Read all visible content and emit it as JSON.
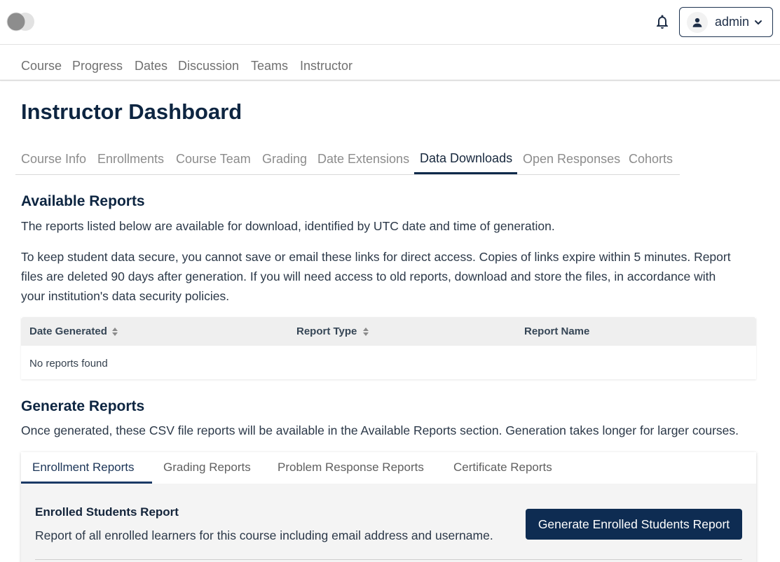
{
  "header": {
    "user_name": "admin",
    "icons": [
      "logo-toggle-icon",
      "bell-icon",
      "person-icon",
      "chevron-down-icon"
    ]
  },
  "course_nav": {
    "items": [
      "Course",
      "Progress",
      "Dates",
      "Discussion",
      "Teams",
      "Instructor"
    ]
  },
  "page_title": "Instructor Dashboard",
  "dashboard_tabs": {
    "items": [
      "Course Info",
      "Enrollments",
      "Course Team",
      "Grading",
      "Date Extensions",
      "Data Downloads",
      "Open Responses",
      "Cohorts"
    ],
    "active": "Data Downloads"
  },
  "available_reports": {
    "heading": "Available Reports",
    "intro": "The reports listed below are available for download, identified by UTC date and time of generation.",
    "warning_line1": "To keep student data secure, you cannot save or email these links for direct access. Copies of links expire within 5 minutes. Report",
    "warning_line2": "files are deleted 90 days after generation. If you will need access to old reports, download and store the files, in accordance with",
    "warning_line3": "your institution's data security policies.",
    "table": {
      "columns": [
        "Date Generated",
        "Report Type",
        "Report Name"
      ],
      "empty_text": "No reports found"
    }
  },
  "generate_reports": {
    "heading": "Generate Reports",
    "intro": "Once generated, these CSV file reports will be available in the Available Reports section. Generation takes longer for larger courses.",
    "tabs": [
      "Enrollment Reports",
      "Grading Reports",
      "Problem Response Reports",
      "Certificate Reports"
    ],
    "active_tab": "Enrollment Reports",
    "report": {
      "title": "Enrolled Students Report",
      "description": "Report of all enrolled learners for this course including email address and username.",
      "button_label": "Generate Enrolled Students Report"
    }
  },
  "colors": {
    "brand_dark": "#0e2c52",
    "heading": "#0d2541",
    "muted_nav": "#707070"
  }
}
